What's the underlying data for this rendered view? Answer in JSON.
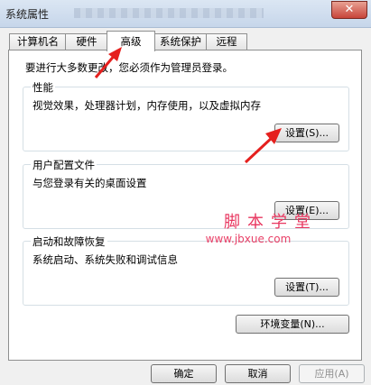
{
  "window": {
    "title": "系统属性",
    "close_glyph": "✕"
  },
  "tabs": [
    {
      "label": "计算机名"
    },
    {
      "label": "硬件"
    },
    {
      "label": "高级",
      "active": true
    },
    {
      "label": "系统保护"
    },
    {
      "label": "远程"
    }
  ],
  "intro": "要进行大多数更改，您必须作为管理员登录。",
  "groups": {
    "performance": {
      "title": "性能",
      "description": "视觉效果，处理器计划，内存使用，以及虚拟内存",
      "button": "设置(S)..."
    },
    "user_profiles": {
      "title": "用户配置文件",
      "description": "与您登录有关的桌面设置",
      "button": "设置(E)..."
    },
    "startup_recovery": {
      "title": "启动和故障恢复",
      "description": "系统启动、系统失败和调试信息",
      "button": "设置(T)..."
    }
  },
  "env_button": "环境变量(N)...",
  "footer": {
    "ok": "确定",
    "cancel": "取消",
    "apply": "应用(A)"
  },
  "watermark": {
    "text": "脚本学堂",
    "url": "www.jbxue.com"
  },
  "colors": {
    "annotation_arrow": "#e5201e",
    "watermark": "#e8365f"
  },
  "icons": [
    "close-icon",
    "annotation-arrow-icon"
  ]
}
